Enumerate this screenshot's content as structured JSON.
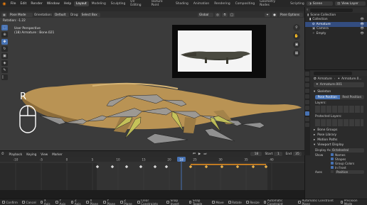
{
  "topbar": {
    "menus": [
      "File",
      "Edit",
      "Render",
      "Window",
      "Help"
    ],
    "workspaces": [
      "Layout",
      "Modeling",
      "Sculpting",
      "UV Editing",
      "Texture Paint",
      "Shading",
      "Animation",
      "Rendering",
      "Compositing",
      "Geometry Nodes",
      "Scripting"
    ],
    "active_workspace": "Layout",
    "scene": "Scene",
    "view_layer": "View Layer"
  },
  "toolbar": {
    "mode": "Pose Mode",
    "orientation_label": "Orientation:",
    "orientation": "Default",
    "drag_label": "Drag:",
    "drag": "Select Box",
    "transform": "Global",
    "pose_options": "Pose Options"
  },
  "viewport": {
    "rotation": "Rotation: -1.22",
    "view_name": "User Perspective",
    "object_info": "(18) Armature : Bone.021",
    "key_hint": "R"
  },
  "outliner": {
    "rows": [
      "Scene Collection",
      "Collection",
      "Armature",
      "Camera",
      "Empty"
    ]
  },
  "properties": {
    "object_name": "Armature",
    "data_name": "Armature.0...",
    "datablock": "Armature.001",
    "skeleton_label": "Skeleton",
    "pose_position": "Pose Position",
    "rest_position": "Rest Position",
    "layers_label": "Layers:",
    "protected_layers_label": "Protected Layers:",
    "sections": [
      "Bone Groups",
      "Pose Library",
      "Motion Paths",
      "Viewport Display"
    ],
    "display_as_label": "Display As",
    "display_as_value": "Octahedral",
    "show_label": "Show",
    "show_items": [
      "Names",
      "Shapes",
      "Group Colors",
      "In Front"
    ],
    "axes_label": "Axes",
    "position_label": "Position"
  },
  "timeline": {
    "playback": "Playback",
    "keying": "Keying",
    "view": "View",
    "marker": "Marker",
    "current_frame": "18",
    "start_label": "Start",
    "start": "1",
    "end_label": "End",
    "end": "35",
    "ruler": [
      "-10",
      "-5",
      "0",
      "5",
      "10",
      "15",
      "18",
      "20",
      "25",
      "30",
      "35",
      "40"
    ]
  },
  "statusbar": {
    "items": [
      "Confirm",
      "Cancel",
      "X Axis",
      "Y Axis",
      "Z Axis",
      "X Plane",
      "Y Plane",
      "Z Plane",
      "Clear Constraints",
      "Snap Invert",
      "Snap Toggle",
      "Move",
      "Rotate",
      "Resize",
      "Automatic Constraint",
      "Automatic Constraint Plane",
      "Precision Mode"
    ]
  },
  "colors": {
    "accent": "#4772b3",
    "bone": "#9a9a9a",
    "bone_selected": "#c8c85a",
    "current_frame": "#4772b3",
    "keyframe_range": "#e08a1e"
  }
}
